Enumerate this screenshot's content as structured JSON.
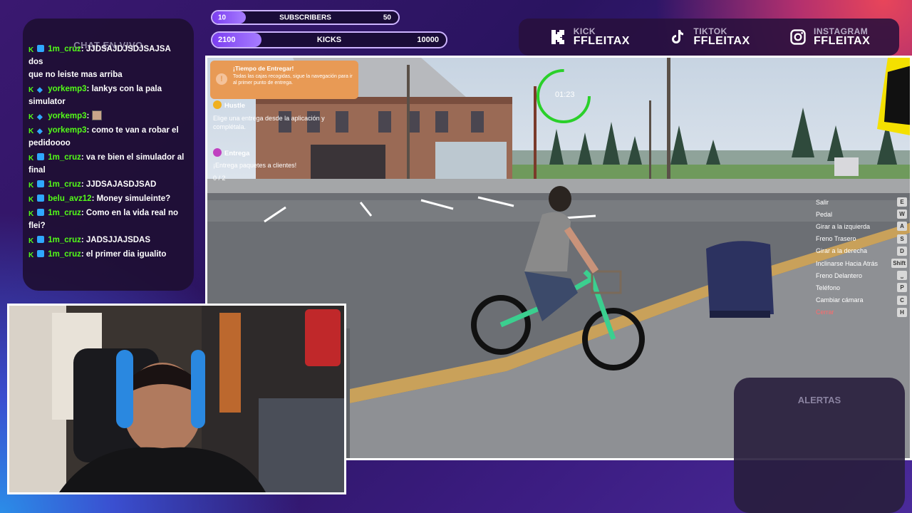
{
  "bars": {
    "subscribers": {
      "title": "SUBSCRIBERS",
      "min": "10",
      "max": "50",
      "progress": 0.18
    },
    "kicks": {
      "title": "KICKS",
      "min": "2100",
      "max": "10000",
      "progress": 0.21
    }
  },
  "socials": [
    {
      "network": "KICK",
      "user": "FFLEITAX",
      "icon": "kick-logo-icon"
    },
    {
      "network": "TIKTOK",
      "user": "FFLEITAX",
      "icon": "tiktok-logo-icon"
    },
    {
      "network": "INSTAGRAM",
      "user": "FFLEITAX",
      "icon": "instagram-logo-icon"
    }
  ],
  "chat": {
    "title": "CHAT EN VIVO",
    "messages": [
      {
        "user": "1m_cruz",
        "text": ": JJDSAJDJSDJSAJSA dos",
        "cont": "que no leiste mas arriba"
      },
      {
        "user": "yorkemp3",
        "text": ": lankys con la pala simulator"
      },
      {
        "user": "yorkemp3",
        "text": ":",
        "emote": true
      },
      {
        "user": "yorkemp3",
        "text": ": como te van a robar el pedidoooo"
      },
      {
        "user": "1m_cruz",
        "text": ": va re bien el simulador al final"
      },
      {
        "user": "1m_cruz",
        "text": ": JJDSAJASDJSAD"
      },
      {
        "user": "belu_avz12",
        "text": ": Money simuleinte?"
      },
      {
        "user": "1m_cruz",
        "text": ": Como en la vida real no flei?"
      },
      {
        "user": "1m_cruz",
        "text": ": JADSJJAJSDAS"
      },
      {
        "user": "1m_cruz",
        "text": ": el primer dia igualito"
      }
    ]
  },
  "game": {
    "toast": {
      "title": "¡Tiempo de Entregar!",
      "body": "Todas las cajas recogidas, sigue la navegación para ir al primer punto de entrega."
    },
    "missions": [
      {
        "title": "Hustle",
        "desc": "Elige una entrega desde la aplicación y complétala.",
        "color": "#f0b020"
      },
      {
        "title": "Entrega",
        "desc": "¡Entrega paquetes a clientes!",
        "color": "#c040c0"
      }
    ],
    "counter": "0 / 2",
    "timer": "01:23",
    "controls": [
      {
        "label": "Salir",
        "key": "E"
      },
      {
        "label": "Pedal",
        "key": "W"
      },
      {
        "label": "Girar a la izquierda",
        "key": "A"
      },
      {
        "label": "Freno Trasero",
        "key": "S"
      },
      {
        "label": "Girar a la derecha",
        "key": "D"
      },
      {
        "label": "Inclinarse Hacia Atrás",
        "key": "Shift"
      },
      {
        "label": "Freno Delantero",
        "key": "⎵"
      },
      {
        "label": "Teléfono",
        "key": "P"
      },
      {
        "label": "Cambiar cámara",
        "key": "C"
      },
      {
        "label": "Cerrar",
        "key": "H"
      }
    ]
  },
  "alerts": {
    "title": "ALERTAS"
  },
  "colors": {
    "accent": "#7b3df0",
    "kick_green": "#53fc18",
    "toast": "#e89a55"
  }
}
